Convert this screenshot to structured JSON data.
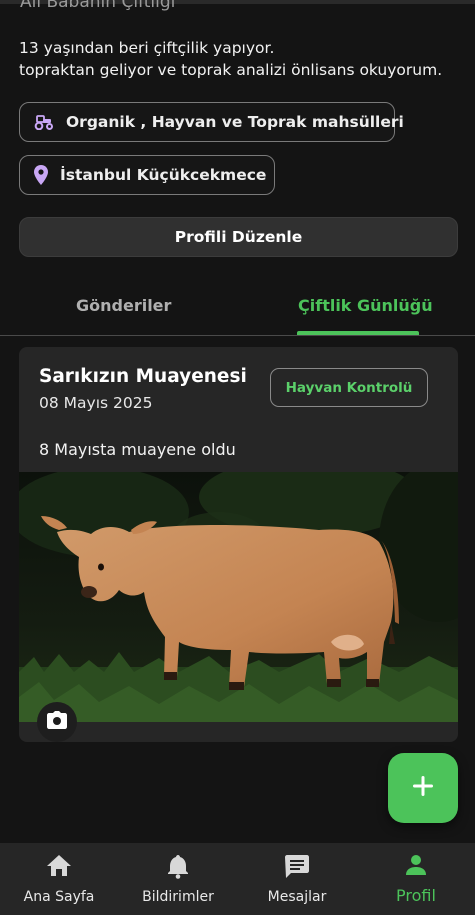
{
  "profile": {
    "farm_name": "Ali Babanın Çiftliği",
    "bio_line_1": "13 yaşından beri çiftçilik yapıyor.",
    "bio_line_2": "topraktan geliyor ve toprak analizi önlisans okuyorum.",
    "interests": "Organik , Hayvan ve Toprak mahsülleri",
    "location": "İstanbul Küçükcekmece",
    "edit_button": "Profili Düzenle"
  },
  "tabs": [
    {
      "label": "Gönderiler",
      "active": false
    },
    {
      "label": "Çiftlik Günlüğü",
      "active": true
    }
  ],
  "diary_entry": {
    "title": "Sarıkızın Muayenesi",
    "date": "08 Mayıs 2025",
    "category": "Hayvan Kontrolü",
    "body": "8 Mayısta muayene oldu"
  },
  "bottom_nav": [
    {
      "label": "Ana Sayfa",
      "icon": "home-icon",
      "active": false
    },
    {
      "label": "Bildirimler",
      "icon": "bell-icon",
      "active": false
    },
    {
      "label": "Mesajlar",
      "icon": "message-icon",
      "active": false
    },
    {
      "label": "Profil",
      "icon": "person-icon",
      "active": true
    }
  ],
  "colors": {
    "accent": "#4cc35a",
    "background": "#141414",
    "card": "#262626",
    "chip_icon": "#c9a7f5"
  }
}
